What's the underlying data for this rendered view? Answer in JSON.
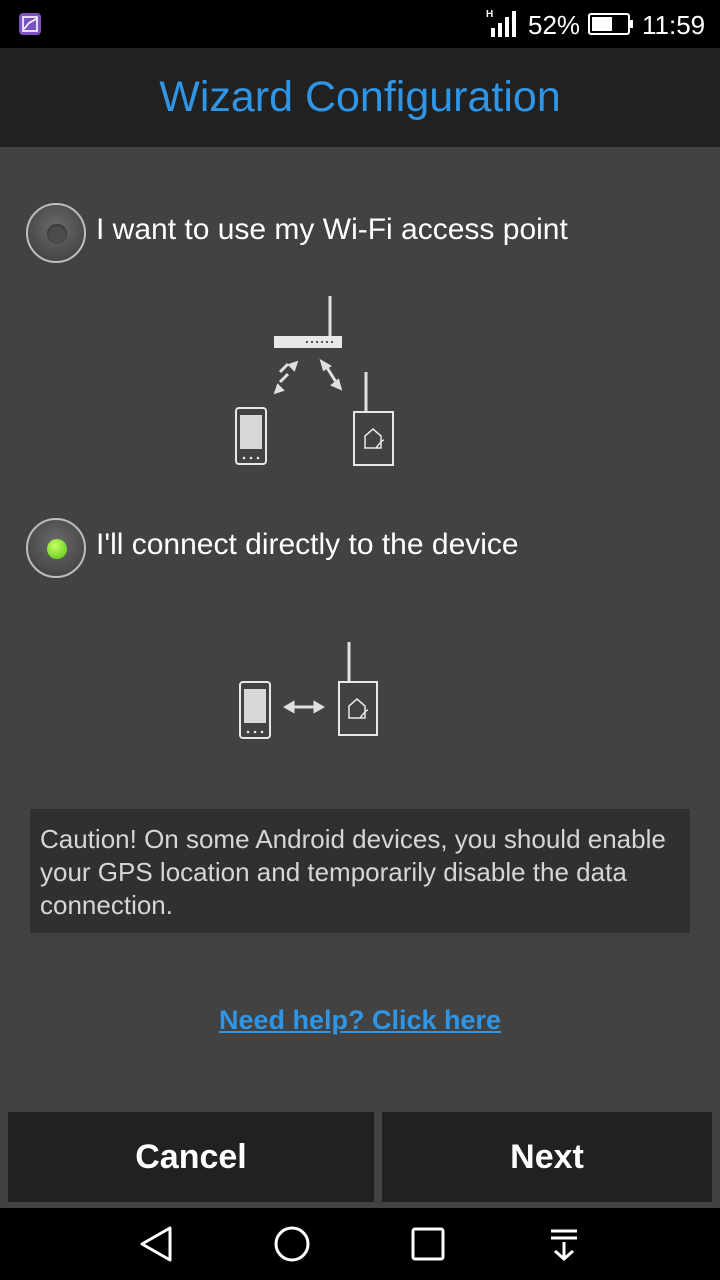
{
  "status_bar": {
    "network_type": "H",
    "battery_percent": "52%",
    "time": "11:59",
    "icons": [
      "gallery-icon",
      "signal-icon",
      "battery-icon"
    ]
  },
  "header": {
    "title": "Wizard Configuration"
  },
  "options": [
    {
      "label": "I want to use my Wi-Fi access point",
      "selected": false
    },
    {
      "label": "I'll connect directly to the device",
      "selected": true
    }
  ],
  "caution": {
    "text": "Caution! On some Android devices, you should enable your GPS location and temporarily disable the data connection."
  },
  "help_link": "Need help? Click here",
  "buttons": {
    "cancel": "Cancel",
    "next": "Next"
  },
  "navbar": {
    "icons": [
      "back-icon",
      "home-icon",
      "recents-icon",
      "notifications-down-icon"
    ]
  },
  "colors": {
    "accent": "#2f95e4",
    "selected_radio": "#7ed321",
    "background": "#424242",
    "bar": "#212121"
  }
}
